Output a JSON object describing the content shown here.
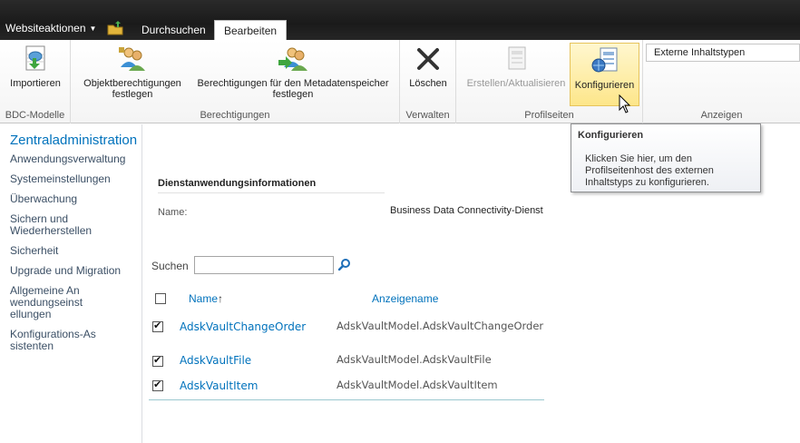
{
  "topbar": {
    "site_actions_label": "Websiteaktionen",
    "tabs": [
      {
        "label": "Durchsuchen"
      },
      {
        "label": "Bearbeiten"
      }
    ]
  },
  "ribbon": {
    "groups": [
      {
        "label": "BDC-Modelle",
        "buttons": [
          {
            "label": "Importieren",
            "icon": "import-icon"
          }
        ]
      },
      {
        "label": "Berechtigungen",
        "buttons": [
          {
            "label": "Objektberechtigungen festlegen",
            "icon": "users-icon"
          },
          {
            "label": "Berechtigungen für den Metadatenspeicher festlegen",
            "icon": "users-arrow-icon"
          }
        ]
      },
      {
        "label": "Verwalten",
        "buttons": [
          {
            "label": "Löschen",
            "icon": "delete-icon"
          }
        ]
      },
      {
        "label": "Profilseiten",
        "buttons": [
          {
            "label": "Erstellen/Aktualisieren",
            "icon": "create-update-icon"
          },
          {
            "label": "Konfigurieren",
            "icon": "configure-icon"
          }
        ]
      },
      {
        "label": "Anzeigen",
        "dropdown_value": "Externe Inhaltstypen"
      }
    ]
  },
  "tooltip": {
    "title": "Konfigurieren",
    "body": "Klicken Sie hier, um den Profilseitenhost des externen Inhaltstyps zu konfigurieren."
  },
  "leftnav": {
    "title": "Zentraladministration",
    "items": [
      "Anwendungsverwaltung",
      "Systemeinstellungen",
      "Überwachung",
      "Sichern und Wiederherstellen",
      "Sicherheit",
      "Upgrade und Migration",
      "Allgemeine Anwendungseinstellungen",
      "Konfigurations-Assistenten"
    ]
  },
  "info": {
    "heading": "Dienstanwendungsinformationen",
    "name_label": "Name:",
    "name_value": "Business Data Connectivity-Dienst"
  },
  "search": {
    "label": "Suchen",
    "value": ""
  },
  "table": {
    "columns": [
      "Name",
      "Anzeigename"
    ],
    "sort_indicator": "↑",
    "rows": [
      {
        "name": "AdskVaultChangeOrder",
        "display": "AdskVaultModel.AdskVaultChangeOrder",
        "checked": true
      },
      {
        "name": "AdskVaultFile",
        "display": "AdskVaultModel.AdskVaultFile",
        "checked": true
      },
      {
        "name": "AdskVaultItem",
        "display": "AdskVaultModel.AdskVaultItem",
        "checked": true
      }
    ]
  },
  "colors": {
    "link": "#0072bc",
    "topbar": "#1f1f1f",
    "hover": "#fde68a"
  }
}
